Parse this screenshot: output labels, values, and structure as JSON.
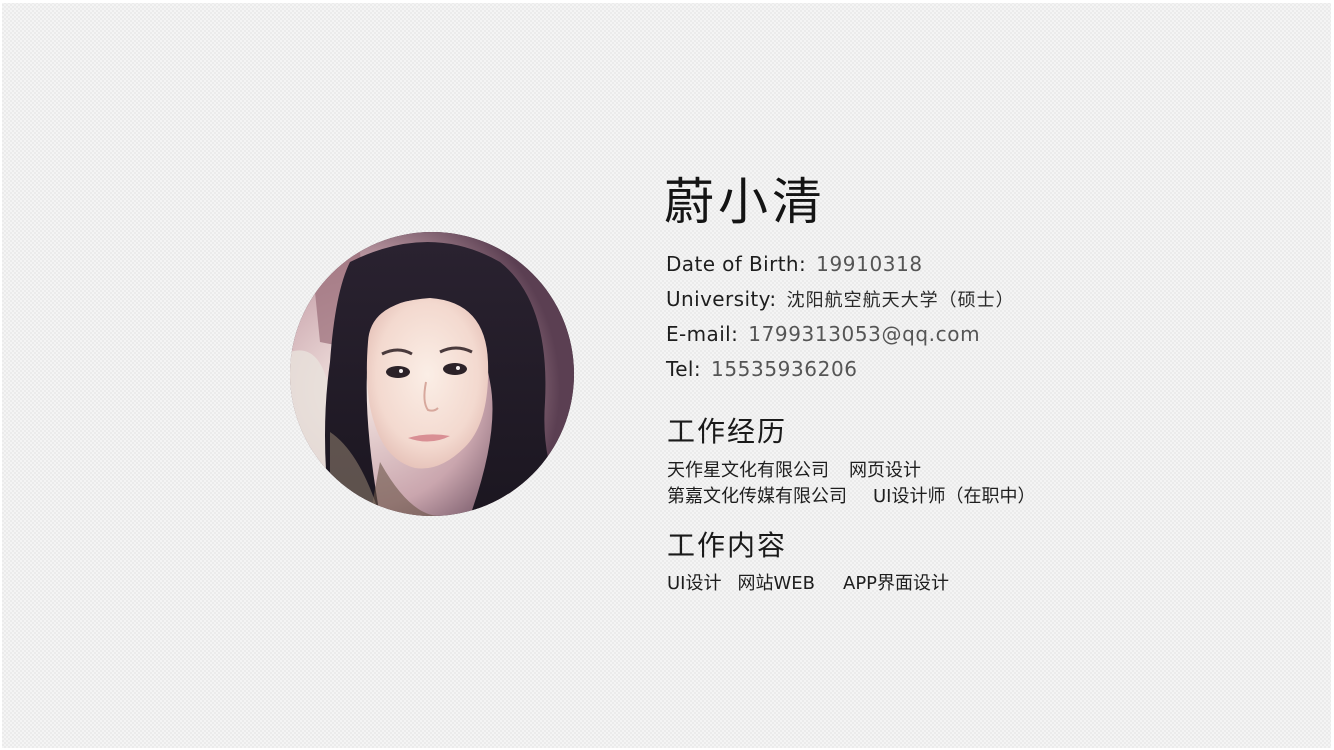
{
  "profile": {
    "name": "蔚小清",
    "birth": {
      "label": "Date of Birth:",
      "value": "19910318"
    },
    "university": {
      "label": "University:",
      "value": "沈阳航空航天大学（硕士）"
    },
    "email": {
      "label": "E-mail:",
      "value": "1799313053@qq.com"
    },
    "tel": {
      "label": "Tel:",
      "value": "15535936206"
    }
  },
  "experience": {
    "title": "工作经历",
    "jobs": [
      {
        "company": "天作星文化有限公司",
        "role": "网页设计"
      },
      {
        "company": "第嘉文化传媒有限公司",
        "role": "UI设计师（在职中）"
      }
    ]
  },
  "work_content": {
    "title": "工作内容",
    "items": [
      "UI设计",
      "网站WEB",
      "APP界面设计"
    ]
  },
  "colors": {
    "background": "#f4f4f4",
    "text": "#1e1e1e",
    "muted": "#555555"
  }
}
